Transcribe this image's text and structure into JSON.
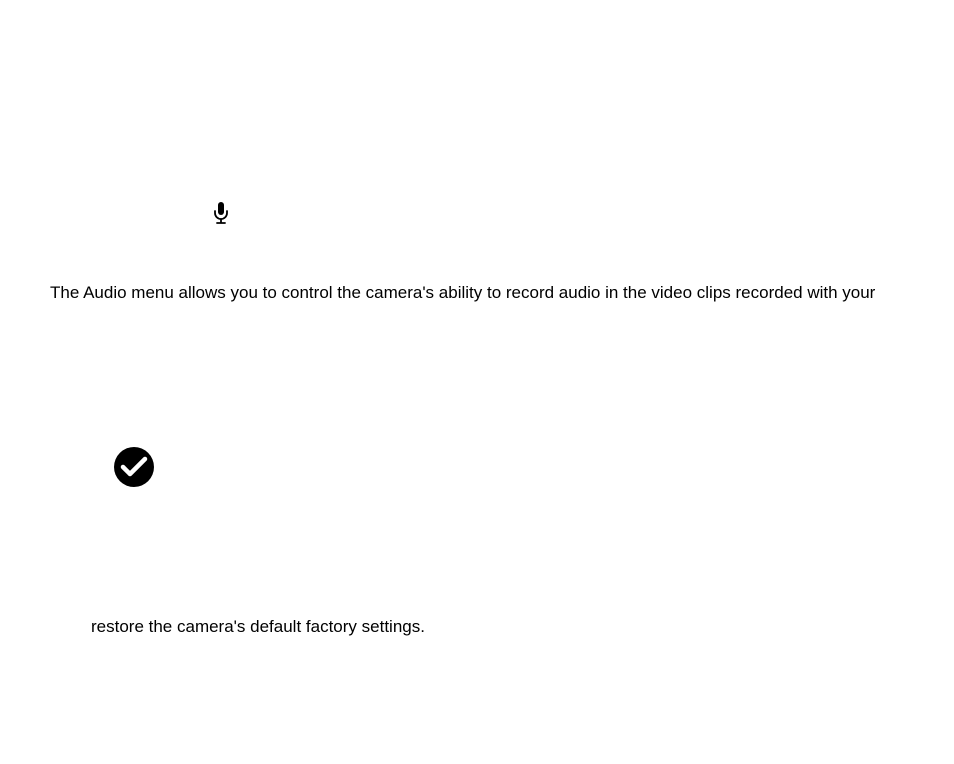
{
  "audio_section": {
    "description": "The Audio menu allows you to control the camera's ability to record audio in the video clips recorded with your"
  },
  "reset_section": {
    "description": "restore the camera's default factory settings."
  }
}
